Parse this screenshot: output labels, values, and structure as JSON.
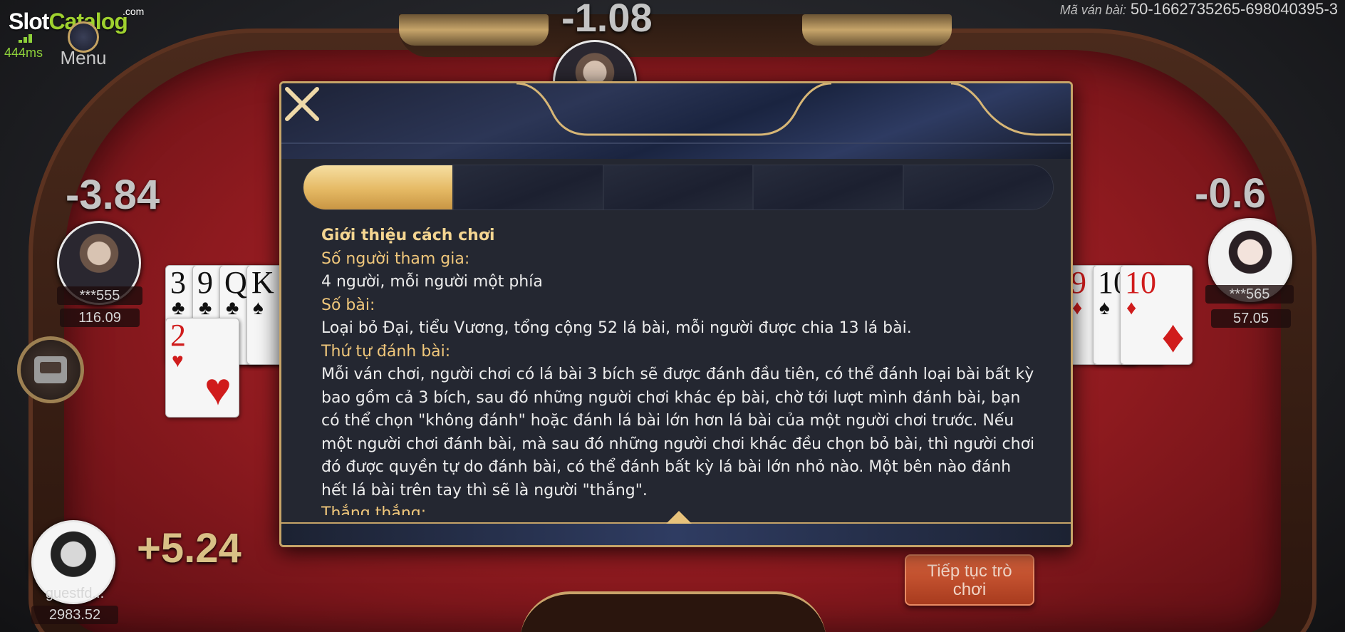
{
  "brand": {
    "name_part1": "Slot",
    "name_part2": "Catalog",
    "suffix": ".com"
  },
  "network": {
    "ping": "444ms"
  },
  "menu": {
    "label": "Menu"
  },
  "round": {
    "label": "Mã ván bài:",
    "id": "50-1662735265-698040395-3"
  },
  "players": {
    "top": {
      "score": "-1.08"
    },
    "left": {
      "score": "-3.84",
      "name": "***555",
      "balance": "116.09"
    },
    "right": {
      "score": "-0.6",
      "name": "***565",
      "balance": "57.05"
    },
    "me": {
      "score": "+5.24",
      "name": "guestfd...",
      "balance": "2983.52"
    }
  },
  "cards": {
    "left": [
      {
        "rank": "3",
        "suit": "♣",
        "color": "black"
      },
      {
        "rank": "9",
        "suit": "♣",
        "color": "black"
      },
      {
        "rank": "Q",
        "suit": "♣",
        "color": "black"
      },
      {
        "rank": "K",
        "suit": "♠",
        "color": "black"
      },
      {
        "rank": "2",
        "suit": "♥",
        "color": "red"
      }
    ],
    "right": [
      {
        "rank": "9",
        "suit": "♦",
        "color": "red"
      },
      {
        "rank": "10",
        "suit": "♠",
        "color": "black"
      },
      {
        "rank": "10",
        "suit": "♦",
        "color": "red"
      }
    ]
  },
  "continue_button": {
    "label_line1": "Tiếp tục trò",
    "label_line2": "chơi"
  },
  "modal": {
    "tabs_count": 5,
    "active_tab": 0,
    "content": {
      "title": "Giới thiệu cách chơi",
      "sections": [
        {
          "heading": "Số người tham gia:",
          "body": "4 người, mỗi người một phía"
        },
        {
          "heading": "Số bài:",
          "body": "Loại bỏ Đại, tiểu Vương, tổng cộng 52 lá bài, mỗi người được chia 13 lá bài."
        },
        {
          "heading": "Thứ tự đánh bài:",
          "body": "Mỗi ván chơi, người chơi có lá bài 3 bích sẽ được đánh đầu tiên, có thể đánh loại bài bất kỳ bao gồm cả 3 bích, sau đó những người chơi khác ép bài, chờ tới lượt mình đánh bài, bạn có thể chọn \"không đánh\" hoặc đánh lá bài lớn hơn lá bài của một người chơi trước. Nếu một người chơi đánh bài, mà sau đó những người chơi khác đều chọn bỏ bài, thì người chơi đó được quyền tự do đánh bài, có thể đánh bất kỳ lá bài lớn nhỏ nào. Một bên nào đánh hết lá bài trên tay thì sẽ là người \"thắng\"."
        },
        {
          "heading": "Thắng thắng:",
          "body": ""
        }
      ]
    }
  },
  "colors": {
    "gold": "#c6a468",
    "heading": "#f0c77b",
    "felt": "#a3212a",
    "accent_green": "#9fd12f"
  }
}
